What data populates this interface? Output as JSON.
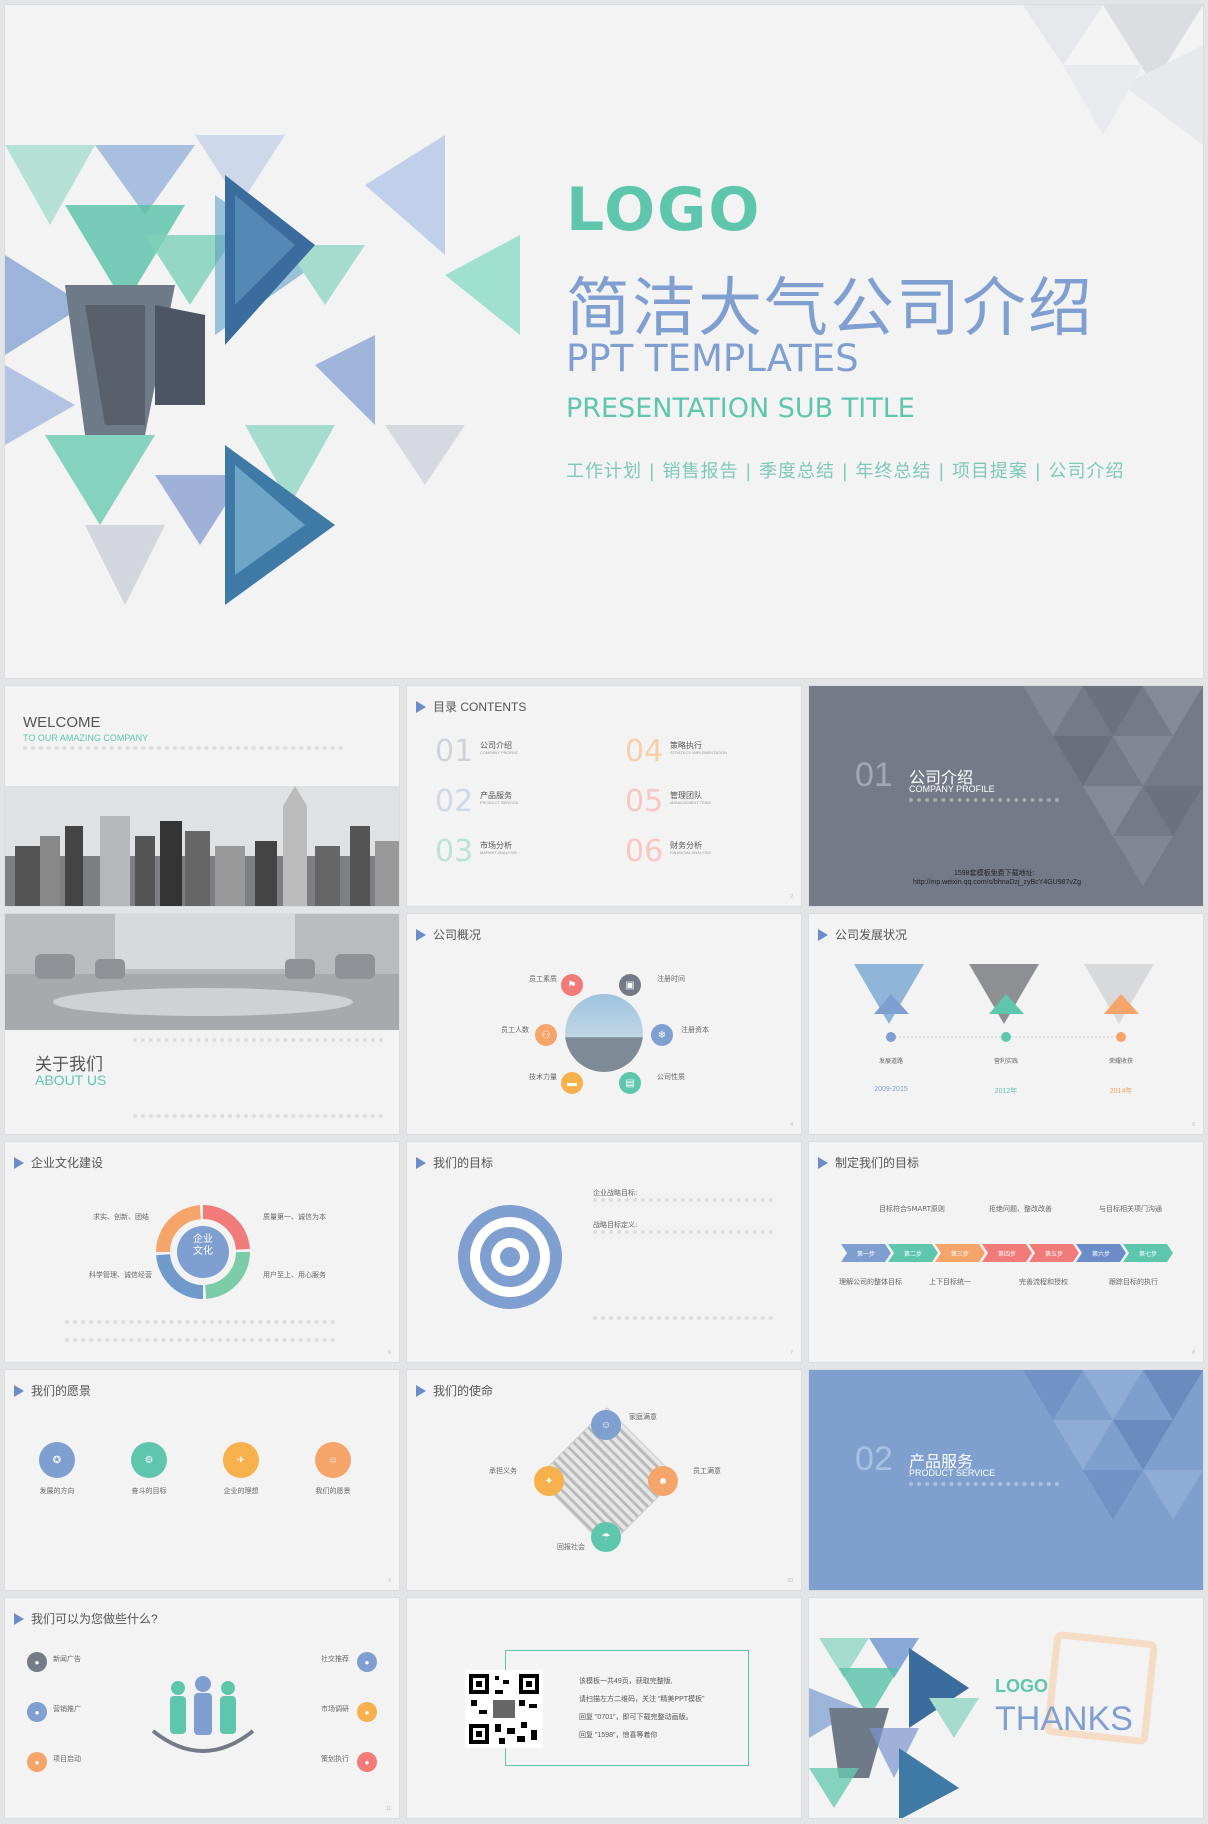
{
  "hero": {
    "logo": "LOGO",
    "title": "简洁大气公司介绍",
    "subtitle": "PPT TEMPLATES",
    "subtitle2": "PRESENTATION SUB TITLE",
    "tags": "工作计划 | 销售报告 | 季度总结 | 年终总结 | 项目提案 | 公司介绍"
  },
  "welcome": {
    "title": "WELCOME",
    "subtitle": "TO OUR AMAZING COMPANY"
  },
  "contents": {
    "header": "目录 CONTENTS",
    "items": [
      {
        "num": "01",
        "title": "公司介绍",
        "en": "COMPANY PROFILE"
      },
      {
        "num": "02",
        "title": "产品服务",
        "en": "PRODUCT SERVICE"
      },
      {
        "num": "03",
        "title": "市场分析",
        "en": "MARKET ANALYSIS"
      },
      {
        "num": "04",
        "title": "策略执行",
        "en": "STRATEGY IMPLEMENTATION"
      },
      {
        "num": "05",
        "title": "管理团队",
        "en": "MANAGEMENT TEAM"
      },
      {
        "num": "06",
        "title": "财务分析",
        "en": "FINANCIAL ANALYSIS"
      }
    ]
  },
  "section1": {
    "num": "01",
    "title": "公司介绍",
    "en": "COMPANY PROFILE",
    "note": "1598套模板免费下载地址:",
    "url": "http://mp.weixin.qq.com/s/bhnaDzj_zyBcY4GU987vZg"
  },
  "about": {
    "title": "关于我们",
    "en": "ABOUT US"
  },
  "overview": {
    "header": "公司概况",
    "labels": [
      "员工素质",
      "注册时间",
      "员工人数",
      "注册资本",
      "技术力量",
      "公司性质"
    ]
  },
  "development": {
    "header": "公司发展状况",
    "stages": [
      {
        "label": "发展道路",
        "year": "2009-2015"
      },
      {
        "label": "营利实践",
        "year": "2012年"
      },
      {
        "label": "荣耀收获",
        "year": "2014年"
      }
    ]
  },
  "culture": {
    "header": "企业文化建设",
    "center": "企业\n文化",
    "labels": [
      "求实、创新、团结",
      "质量第一、诚信为本",
      "科学管理、诚信经营",
      "用户至上、用心服务"
    ]
  },
  "goal": {
    "header": "我们的目标",
    "t1": "企业战略目标:",
    "t2": "战略目标定义:"
  },
  "plan": {
    "header": "制定我们的目标",
    "steps": [
      "第一步",
      "第二步",
      "第三步",
      "第四步",
      "第五步",
      "第六步",
      "第七步"
    ],
    "top": [
      "目标符合SMART原则",
      "拒绝问题、整改改善",
      "与目标相关项门沟通"
    ],
    "bottom": [
      "理解公司的整体目标",
      "上下目标统一",
      "完善流程和授权",
      "跟踪目标的执行"
    ]
  },
  "vision": {
    "header": "我们的愿景",
    "items": [
      "发展的方向",
      "奋斗的目标",
      "企业的理想",
      "我们的愿景"
    ]
  },
  "mission": {
    "header": "我们的使命",
    "items": [
      "家庭满意",
      "员工满意",
      "回报社会",
      "承担义务"
    ]
  },
  "section2": {
    "num": "02",
    "title": "产品服务",
    "en": "PRODUCT SERVICE"
  },
  "services": {
    "header": "我们可以为您做些什么?",
    "items": [
      "新闻广告",
      "营销推广",
      "项目启动",
      "社交推荐",
      "市场调研",
      "策划执行"
    ]
  },
  "qr": {
    "lines": [
      "该模板一共49页，获取完整版,",
      "请扫描左方二维码，关注 \"精美PPT模板\"",
      "回复 \"0701\"，即可下载完整动画版。",
      "回复 \"1598\"，惊喜等着你"
    ]
  },
  "thanks": {
    "logo": "LOGO",
    "text": "THANKS"
  },
  "colors": {
    "teal": "#5fc6ae",
    "blue": "#7e9fd0",
    "gray": "#747a87",
    "section_blue": "#7f9fcf"
  }
}
